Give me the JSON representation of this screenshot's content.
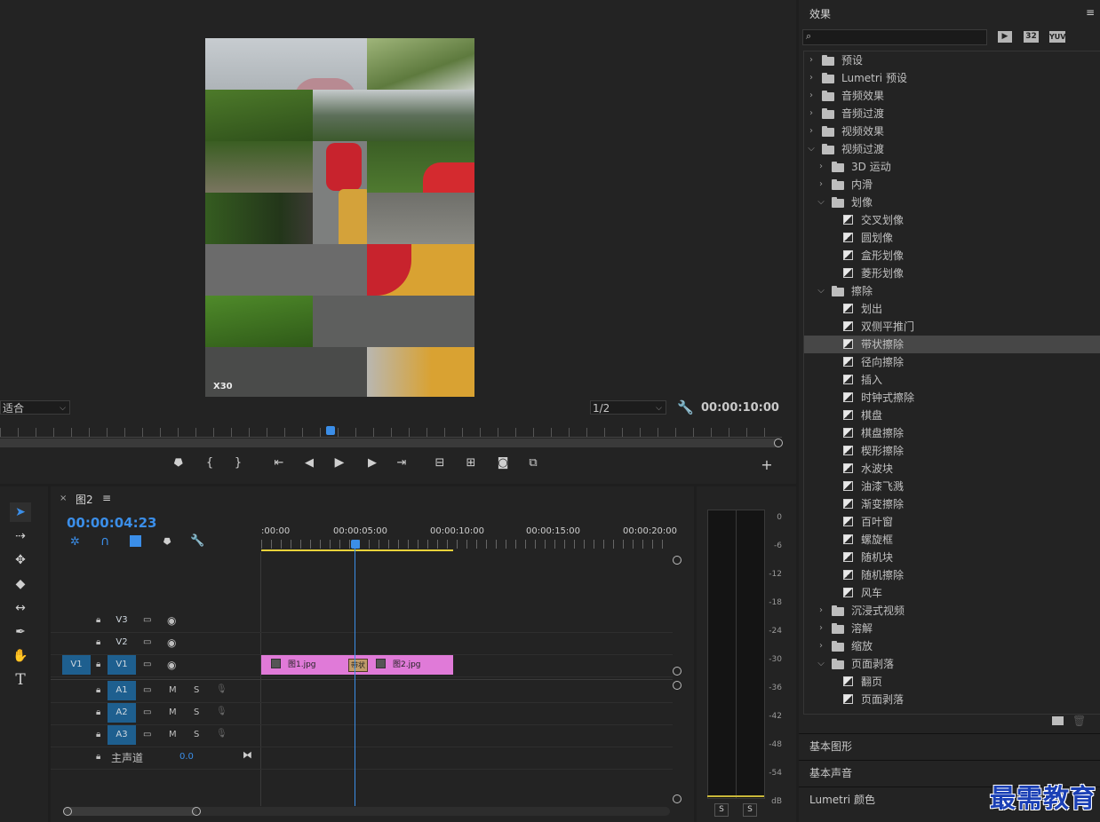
{
  "monitor": {
    "fit_label": "适合",
    "quality_label": "1/2",
    "timecode": "00:00:10:00",
    "watermark": "X30"
  },
  "effects": {
    "title": "效果",
    "menu_icon": "hamburger-icon",
    "filter_buttons": [
      "32",
      "YUV"
    ],
    "tree": [
      {
        "label": "预设",
        "level": 0,
        "type": "folder-star",
        "expanded": false
      },
      {
        "label": "Lumetri 预设",
        "level": 0,
        "type": "folder-star",
        "expanded": false
      },
      {
        "label": "音频效果",
        "level": 0,
        "type": "folder",
        "expanded": false
      },
      {
        "label": "音频过渡",
        "level": 0,
        "type": "folder",
        "expanded": false
      },
      {
        "label": "视频效果",
        "level": 0,
        "type": "folder",
        "expanded": false
      },
      {
        "label": "视频过渡",
        "level": 0,
        "type": "folder",
        "expanded": true
      },
      {
        "label": "3D 运动",
        "level": 1,
        "type": "folder",
        "expanded": false
      },
      {
        "label": "内滑",
        "level": 1,
        "type": "folder",
        "expanded": false
      },
      {
        "label": "划像",
        "level": 1,
        "type": "folder",
        "expanded": true
      },
      {
        "label": "交叉划像",
        "level": 2,
        "type": "effect"
      },
      {
        "label": "圆划像",
        "level": 2,
        "type": "effect"
      },
      {
        "label": "盒形划像",
        "level": 2,
        "type": "effect"
      },
      {
        "label": "菱形划像",
        "level": 2,
        "type": "effect"
      },
      {
        "label": "擦除",
        "level": 1,
        "type": "folder",
        "expanded": true
      },
      {
        "label": "划出",
        "level": 2,
        "type": "effect"
      },
      {
        "label": "双侧平推门",
        "level": 2,
        "type": "effect"
      },
      {
        "label": "带状擦除",
        "level": 2,
        "type": "effect",
        "selected": true
      },
      {
        "label": "径向擦除",
        "level": 2,
        "type": "effect"
      },
      {
        "label": "插入",
        "level": 2,
        "type": "effect"
      },
      {
        "label": "时钟式擦除",
        "level": 2,
        "type": "effect"
      },
      {
        "label": "棋盘",
        "level": 2,
        "type": "effect"
      },
      {
        "label": "棋盘擦除",
        "level": 2,
        "type": "effect"
      },
      {
        "label": "楔形擦除",
        "level": 2,
        "type": "effect"
      },
      {
        "label": "水波块",
        "level": 2,
        "type": "effect"
      },
      {
        "label": "油漆飞溅",
        "level": 2,
        "type": "effect"
      },
      {
        "label": "渐变擦除",
        "level": 2,
        "type": "effect"
      },
      {
        "label": "百叶窗",
        "level": 2,
        "type": "effect"
      },
      {
        "label": "螺旋框",
        "level": 2,
        "type": "effect"
      },
      {
        "label": "随机块",
        "level": 2,
        "type": "effect"
      },
      {
        "label": "随机擦除",
        "level": 2,
        "type": "effect"
      },
      {
        "label": "风车",
        "level": 2,
        "type": "effect"
      },
      {
        "label": "沉浸式视频",
        "level": 1,
        "type": "folder",
        "expanded": false
      },
      {
        "label": "溶解",
        "level": 1,
        "type": "folder",
        "expanded": false
      },
      {
        "label": "缩放",
        "level": 1,
        "type": "folder",
        "expanded": false
      },
      {
        "label": "页面剥落",
        "level": 1,
        "type": "folder",
        "expanded": true
      },
      {
        "label": "翻页",
        "level": 2,
        "type": "effect"
      },
      {
        "label": "页面剥落",
        "level": 2,
        "type": "effect"
      }
    ],
    "sections": [
      "基本图形",
      "基本声音",
      "Lumetri 颜色"
    ]
  },
  "timeline": {
    "tab_name": "图2",
    "timecode": "00:00:04:23",
    "ruler_labels": [
      ":00:00",
      "00:00:05:00",
      "00:00:10:00",
      "00:00:15:00",
      "00:00:20:00"
    ],
    "tracks": {
      "video": [
        {
          "name": "V3",
          "source": ""
        },
        {
          "name": "V2",
          "source": ""
        },
        {
          "name": "V1",
          "source": "V1"
        }
      ],
      "audio": [
        {
          "name": "A1",
          "m": "M",
          "s": "S"
        },
        {
          "name": "A2",
          "m": "M",
          "s": "S"
        },
        {
          "name": "A3",
          "m": "M",
          "s": "S"
        }
      ],
      "master_label": "主声道",
      "master_value": "0.0"
    },
    "clips": [
      {
        "name": "图1.jpg"
      },
      {
        "name": "图2.jpg"
      }
    ],
    "transition_label": "带状"
  },
  "meters": {
    "scale": [
      "0",
      "-6",
      "-12",
      "-18",
      "-24",
      "-30",
      "-36",
      "-42",
      "-48",
      "-54",
      "dB"
    ],
    "solo_labels": [
      "S",
      "S"
    ]
  },
  "watermark_logo": "最需教育",
  "colors": {
    "accent_blue": "#3b8ee8",
    "clip_pink": "#e07ad8",
    "track_blue": "#1e5f8f",
    "work_area_yellow": "#e8d23a"
  }
}
